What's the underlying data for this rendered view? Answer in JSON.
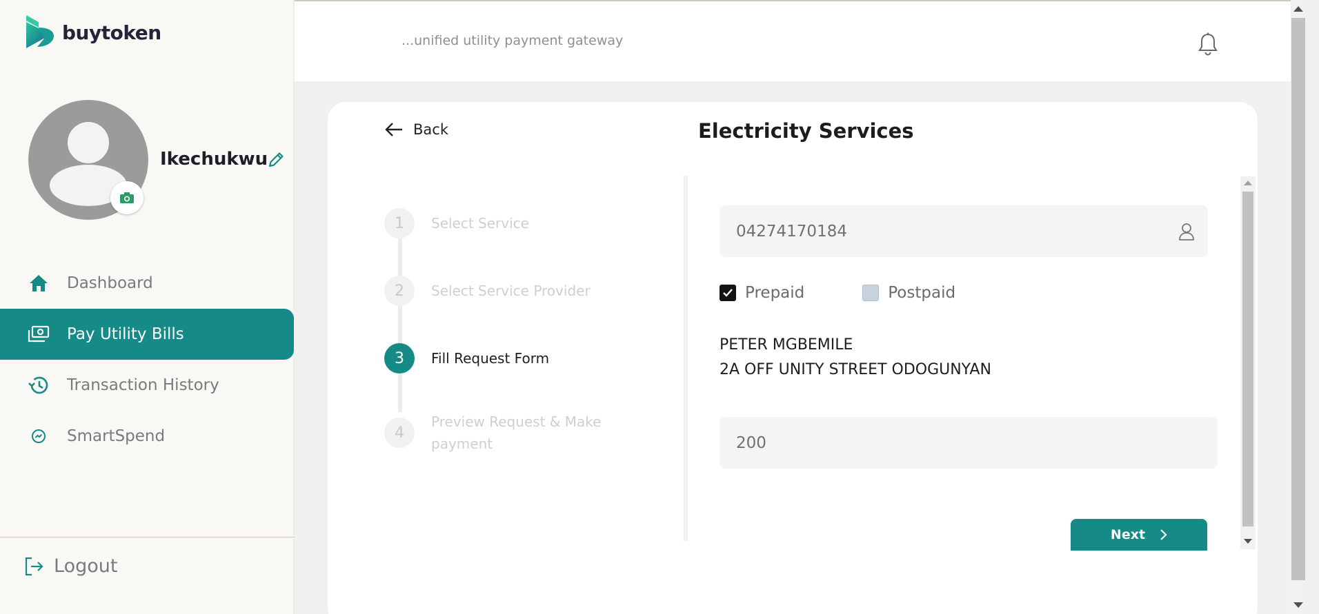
{
  "brand": {
    "name": "buytoken"
  },
  "header": {
    "tagline": "...unified utility payment gateway"
  },
  "profile": {
    "username": "Ikechukwu"
  },
  "sidebar": {
    "items": [
      {
        "label": "Dashboard",
        "icon": "home-icon",
        "active": false
      },
      {
        "label": "Pay Utility Bills",
        "icon": "money-icon",
        "active": true
      },
      {
        "label": "Transaction History",
        "icon": "history-icon",
        "active": false
      },
      {
        "label": "SmartSpend",
        "icon": "smartspend-icon",
        "active": false
      }
    ],
    "logout_label": "Logout"
  },
  "card": {
    "back_label": "Back",
    "title": "Electricity Services"
  },
  "steps": [
    {
      "num": "1",
      "label": "Select Service"
    },
    {
      "num": "2",
      "label": "Select Service Provider"
    },
    {
      "num": "3",
      "label": "Fill Request Form"
    },
    {
      "num": "4",
      "label": "Preview Request & Make payment"
    }
  ],
  "form": {
    "meter_number": "04274170184",
    "prepaid_label": "Prepaid",
    "prepaid_checked": true,
    "postpaid_label": "Postpaid",
    "postpaid_checked": false,
    "customer_name": "PETER MGBEMILE",
    "customer_address": "2A OFF UNITY STREET ODOGUNYAN",
    "amount": "200",
    "next_label": "Next"
  },
  "colors": {
    "accent": "#158a87",
    "sidebar_bg": "#f9f8f5",
    "input_bg": "#f4f4f4"
  }
}
